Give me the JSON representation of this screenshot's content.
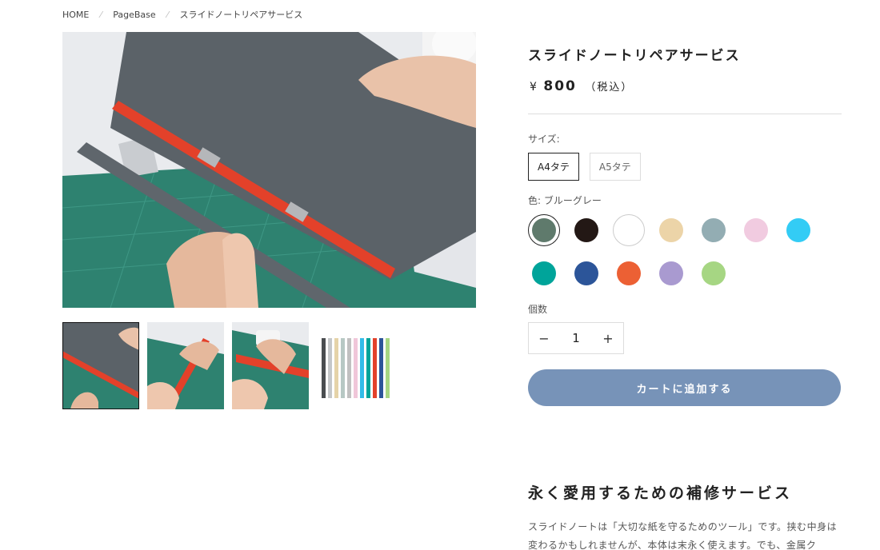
{
  "breadcrumb": {
    "items": [
      "HOME",
      "PageBase",
      "スライドノートリペアサービス"
    ],
    "separator": "⁄"
  },
  "product": {
    "title": "スライドノートリペアサービス",
    "currency": "¥",
    "price": "800",
    "tax_note": "（税込）"
  },
  "size": {
    "label": "サイズ:",
    "options": [
      "A4タテ",
      "A5タテ"
    ],
    "selected": "A4タテ"
  },
  "color": {
    "label": "色: ブルーグレー",
    "swatches": [
      {
        "name": "ブルーグレー",
        "hex": "#5f7a6c",
        "selected": true
      },
      {
        "name": "black",
        "hex": "#231815"
      },
      {
        "name": "white",
        "hex": "#ffffff"
      },
      {
        "name": "beige",
        "hex": "#ecd4a8"
      },
      {
        "name": "grey-blue",
        "hex": "#93adb3"
      },
      {
        "name": "pink",
        "hex": "#f1cbe0"
      },
      {
        "name": "sky",
        "hex": "#33ccf5"
      },
      {
        "name": "teal",
        "hex": "#00a49a"
      },
      {
        "name": "navy",
        "hex": "#2c5599"
      },
      {
        "name": "orange",
        "hex": "#ec6034"
      },
      {
        "name": "lavender",
        "hex": "#a99ad0"
      },
      {
        "name": "green",
        "hex": "#a6d683"
      }
    ]
  },
  "quantity": {
    "label": "個数",
    "minus": "−",
    "value": "1",
    "plus": "+"
  },
  "cart": {
    "label": "カートに追加する"
  },
  "section": {
    "title": "永く愛用するための補修サービス",
    "body": "スライドノートは「大切な紙を守るためのツール」です。挟む中身は変わるかもしれませんが、本体は末永く使えます。でも、金属ク"
  },
  "colors": {
    "accent": "#7793b8",
    "text": "#222222",
    "muted": "#555555"
  }
}
